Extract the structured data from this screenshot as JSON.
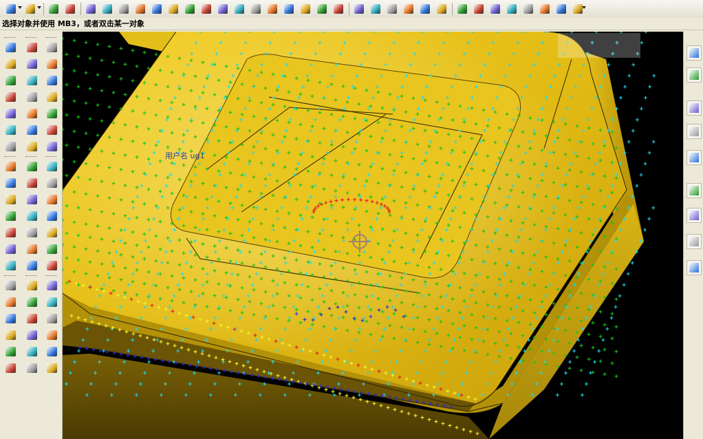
{
  "status_prompt": "选择对象并使用 MB3，或者双击某一对象",
  "viewport": {
    "watermark": "用户名 ug1",
    "colors": {
      "background": "#000000",
      "surface": "#e8c21a",
      "surface_shadow": "#8c6f08",
      "edge": "#3a2e05",
      "points_green": "#19c219",
      "points_cyan": "#22d8e8",
      "points_red": "#e02020",
      "points_yellow": "#f4f430",
      "points_blue": "#2a2ad0"
    }
  },
  "top_toolbar": {
    "icons": [
      "start-icon",
      "model-icon",
      "part-icon",
      "assembly-icon",
      "block-icon",
      "extrude-icon",
      "revolve-icon",
      "sweep-icon",
      "hole-icon",
      "boss-icon",
      "pocket-icon",
      "pad-icon",
      "slot-icon",
      "groove-icon",
      "blend-icon",
      "chamfer-icon",
      "shell-icon",
      "sketch-icon",
      "curve-icon",
      "section-icon",
      "bridge-icon",
      "face-icon",
      "body-icon",
      "measure-icon",
      "analysis-icon",
      "dimension-icon",
      "point-icon",
      "line-icon",
      "arc-icon",
      "spline-icon",
      "offset-icon",
      "trim-icon",
      "extend-icon",
      "fillet-icon"
    ]
  },
  "left_toolbar": {
    "col1": [
      "point-icon",
      "spline-icon",
      "text-icon",
      "point-set-icon",
      "line-icon",
      "rectangle-icon",
      "polygon-icon",
      "helix-icon",
      "offset-curve-icon",
      "bridge-curve-icon",
      "project-curve-icon",
      "intersect-icon",
      "wrap-icon",
      "join-icon",
      "section-curve-icon",
      "mirror-icon",
      "extract-icon",
      "combine-icon",
      "transform-icon",
      "analyze-curve-icon"
    ],
    "col2": [
      "extrude-icon",
      "revolve-icon",
      "sweep-icon",
      "tube-icon",
      "block-icon",
      "cylinder-icon",
      "cone-icon",
      "sphere-icon",
      "hole-icon",
      "boss-icon",
      "pocket-icon",
      "pad-icon",
      "slot-icon",
      "groove-icon",
      "thread-icon",
      "trim-body-icon",
      "split-body-icon",
      "mirror-body-icon",
      "pattern-icon",
      "sew-icon"
    ],
    "col3": [
      "surface-icon",
      "through-curves-icon",
      "mesh-icon",
      "swept-icon",
      "ruled-icon",
      "bounded-plane-icon",
      "offset-surface-icon",
      "extension-icon",
      "law-extension-icon",
      "fillet-surface-icon",
      "blend-icon",
      "chamfer-icon",
      "shell-icon",
      "draft-icon",
      "scale-icon",
      "trim-sheet-icon",
      "thicken-icon",
      "patch-icon",
      "enlarge-icon",
      "analyze-icon"
    ]
  },
  "right_toolbar": {
    "icons": [
      "assembly-navigator-icon",
      "part-navigator-icon",
      "web-browser-icon",
      "history-icon",
      "flag-icon",
      "help-icon",
      "clock-icon",
      "info-icon",
      "tools-icon",
      "roles-icon"
    ]
  }
}
